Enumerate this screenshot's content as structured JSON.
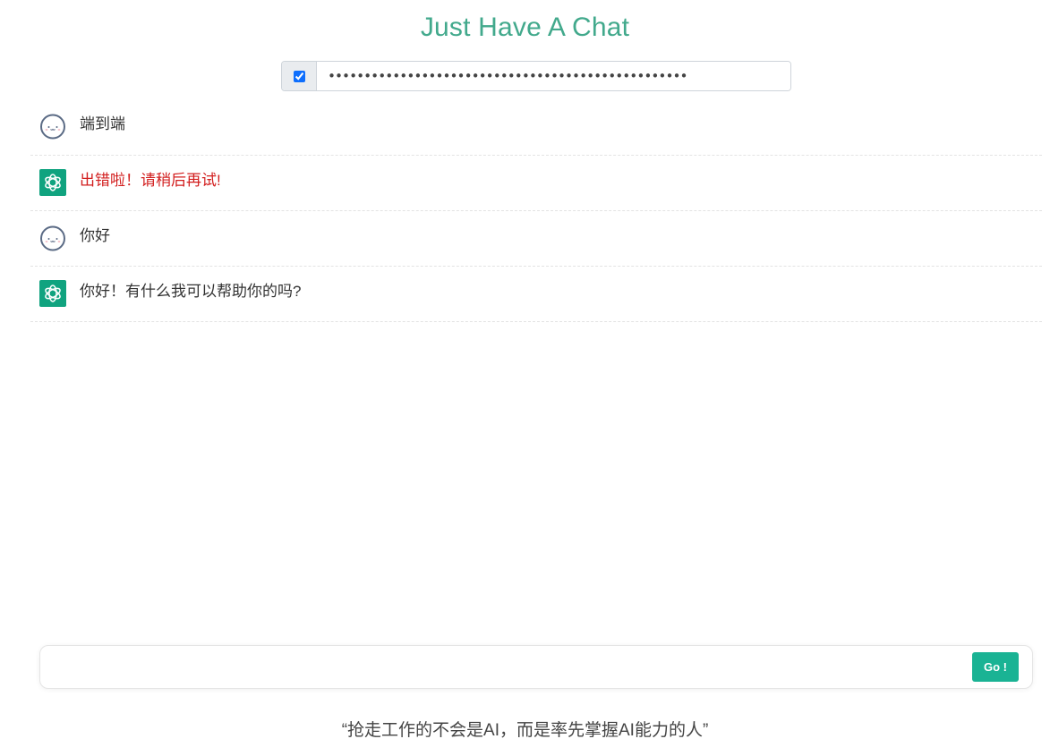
{
  "header": {
    "title": "Just Have A Chat"
  },
  "api_key": {
    "checked": true,
    "value": "••••••••••••••••••••••••••••••••••••••••••••••••••"
  },
  "messages": [
    {
      "role": "user",
      "text": "端到端",
      "error": false,
      "avatar_icon": "cute-face-icon"
    },
    {
      "role": "assistant",
      "text": "出错啦！请稍后再试!",
      "error": true,
      "avatar_icon": "openai-logo-icon"
    },
    {
      "role": "user",
      "text": "你好",
      "error": false,
      "avatar_icon": "cute-face-icon"
    },
    {
      "role": "assistant",
      "text": "你好！有什么我可以帮助你的吗?",
      "error": false,
      "avatar_icon": "openai-logo-icon"
    }
  ],
  "composer": {
    "value": "",
    "placeholder": "",
    "send_label": "Go !"
  },
  "footer": {
    "quote": "“抢走工作的不会是AI，而是率先掌握AI能力的人”"
  },
  "colors": {
    "title": "#42a98c",
    "assistant_avatar_bg": "#10a37f",
    "send_button": "#1ab394",
    "error_text": "#d21e1e"
  }
}
